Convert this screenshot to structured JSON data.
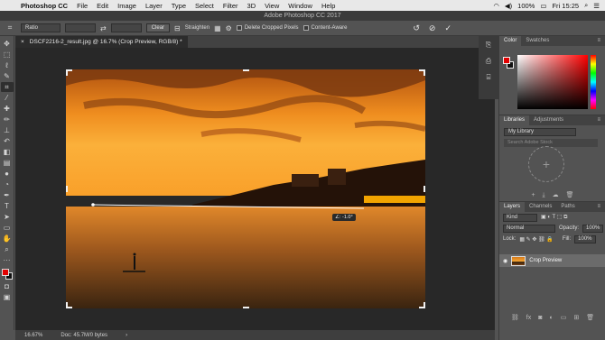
{
  "menubar": {
    "app_name": "Photoshop CC",
    "menus": [
      "File",
      "Edit",
      "Image",
      "Layer",
      "Type",
      "Select",
      "Filter",
      "3D",
      "View",
      "Window",
      "Help"
    ],
    "battery": "100%",
    "clock": "Fri 15:25"
  },
  "window": {
    "title": "Adobe Photoshop CC 2017"
  },
  "options": {
    "ratio_label": "Ratio",
    "clear_label": "Clear",
    "straighten_label": "Straighten",
    "delete_cropped_label": "Delete Cropped Pixels",
    "content_aware_label": "Content-Aware"
  },
  "document": {
    "tab_title": "DSCF2216-2_result.jpg @ 16.7% (Crop Preview, RGB/8) *",
    "close_symbol": "×",
    "angle_readout": "∠: -1.0°"
  },
  "status": {
    "zoom": "16.67%",
    "doc_size": "Doc: 45.7M/0 bytes"
  },
  "panels": {
    "color_tab": "Color",
    "swatches_tab": "Swatches",
    "libraries_tab": "Libraries",
    "adjustments_tab": "Adjustments",
    "library_name": "My Library",
    "library_search": "Search Adobe Stock",
    "layers_tab": "Layers",
    "channels_tab": "Channels",
    "paths_tab": "Paths",
    "kind_label": "Kind",
    "blend_mode": "Normal",
    "opacity_label": "Opacity:",
    "opacity_value": "100%",
    "lock_label": "Lock:",
    "fill_label": "Fill:",
    "fill_value": "100%",
    "layer_name": "Crop Preview"
  },
  "colors": {
    "foreground": "#e10000",
    "background": "#111111",
    "accent_orange": "#f39a22"
  }
}
